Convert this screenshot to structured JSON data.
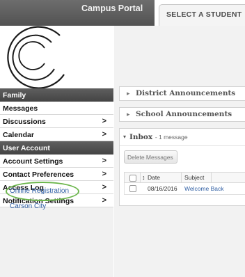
{
  "header": {
    "portal_title": "Campus Portal",
    "select_student_tab": "SELECT A STUDENT"
  },
  "sidebar": {
    "family_header": "Family",
    "family_items": [
      {
        "label": "Messages",
        "chevron": ""
      },
      {
        "label": "Discussions",
        "chevron": ">"
      },
      {
        "label": "Calendar",
        "chevron": ">"
      }
    ],
    "account_header": "User Account",
    "account_items": [
      {
        "label": "Account Settings",
        "chevron": ">"
      },
      {
        "label": "Contact Preferences",
        "chevron": ">"
      },
      {
        "label": "Access Log",
        "chevron": ">"
      },
      {
        "label": "Notification Settings",
        "chevron": ">"
      }
    ],
    "links": {
      "online_registration": "Online Registration",
      "district": "Carson City"
    }
  },
  "main": {
    "district_announcements": "District Announcements",
    "school_announcements": "School Announcements",
    "inbox": {
      "title": "Inbox",
      "count": "- 1 message",
      "delete_button": "Delete Messages",
      "columns": {
        "date": "Date",
        "subject": "Subject"
      },
      "rows": [
        {
          "date": "08/16/2016",
          "subject": "Welcome Back"
        }
      ]
    }
  },
  "icons": {
    "collapsed_arrow": "▸",
    "expanded_arrow": "▾",
    "sort": "↕"
  },
  "colors": {
    "header_dark": "#525252",
    "link_blue": "#2f5ea3",
    "highlight_green": "#6cb64c"
  }
}
